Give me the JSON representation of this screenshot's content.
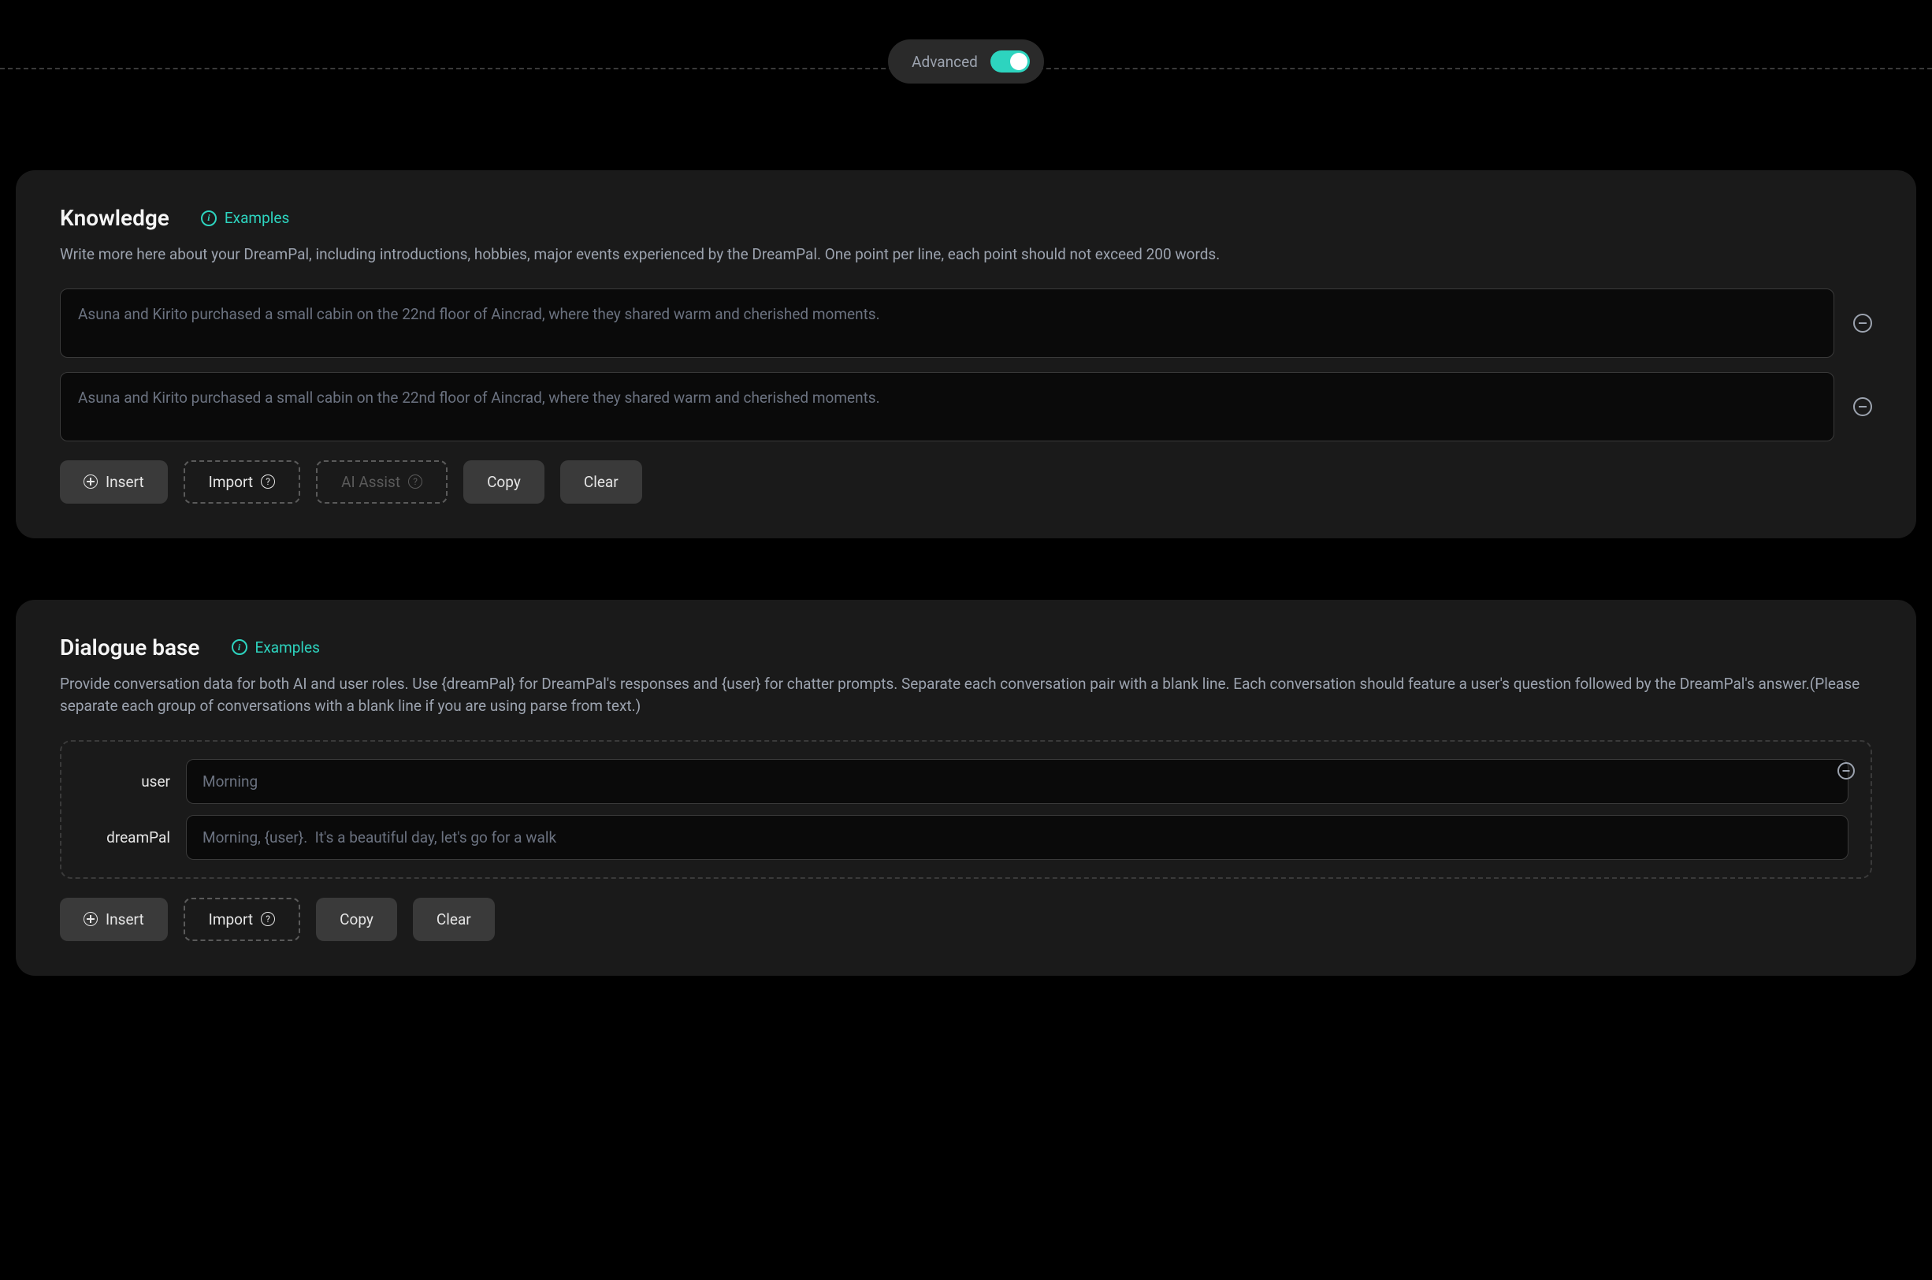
{
  "toggle": {
    "label": "Advanced",
    "state": "on"
  },
  "knowledge": {
    "title": "Knowledge",
    "examples_label": "Examples",
    "description": "Write more here about your DreamPal, including introductions, hobbies, major events experienced by the DreamPal. One point per line, each point should not exceed 200 words.",
    "items": [
      {
        "placeholder": "Asuna and Kirito purchased a small cabin on the 22nd floor of Aincrad, where they shared warm and cherished moments."
      },
      {
        "placeholder": "Asuna and Kirito purchased a small cabin on the 22nd floor of Aincrad, where they shared warm and cherished moments."
      }
    ],
    "buttons": {
      "insert": "Insert",
      "import": "Import",
      "ai_assist": "AI Assist",
      "copy": "Copy",
      "clear": "Clear"
    }
  },
  "dialogue": {
    "title": "Dialogue base",
    "examples_label": "Examples",
    "description": "Provide conversation data for both AI and user roles. Use {dreamPal} for DreamPal's responses and {user} for chatter prompts. Separate each conversation pair with a blank line. Each conversation should feature a user's question followed by the DreamPal's answer.(Please separate each group of conversations with a blank line if you are using parse from text.)",
    "roles": {
      "user_label": "user",
      "dreampal_label": "dreamPal"
    },
    "placeholders": {
      "user": "Morning",
      "dreampal": "Morning, {user}.  It's a beautiful day, let's go for a walk"
    },
    "buttons": {
      "insert": "Insert",
      "import": "Import",
      "copy": "Copy",
      "clear": "Clear"
    }
  }
}
